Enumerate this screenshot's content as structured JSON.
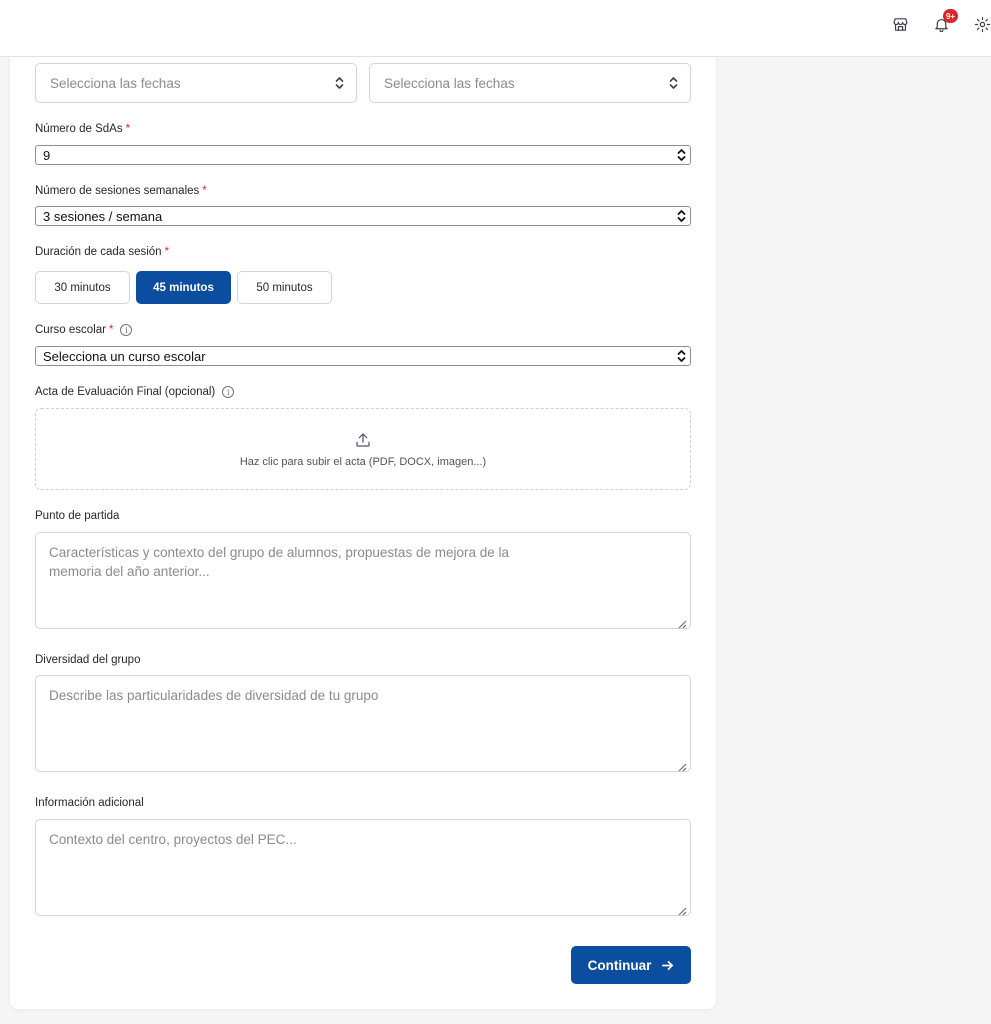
{
  "header": {
    "notification_badge": "9+",
    "icons": [
      "store-icon",
      "bell-icon",
      "gear-icon"
    ]
  },
  "form": {
    "date_start": {
      "placeholder": "Selecciona las fechas"
    },
    "date_end": {
      "placeholder": "Selecciona las fechas"
    },
    "sdas": {
      "label": "Número de SdAs",
      "required": "*",
      "value": "9"
    },
    "sessions": {
      "label": "Número de sesiones semanales",
      "required": "*",
      "value": "3 sesiones / semana"
    },
    "duration": {
      "label": "Duración de cada sesión",
      "required": "*",
      "options": [
        "30 minutos",
        "45 minutos",
        "50 minutos"
      ],
      "selected": "45 minutos"
    },
    "course": {
      "label": "Curso escolar",
      "required": "*",
      "value": "Selecciona un curso escolar"
    },
    "acta": {
      "label": "Acta de Evaluación Final (opcional)",
      "upload_text": "Haz clic para subir el acta (PDF, DOCX, imagen...)"
    },
    "punto_partida": {
      "label": "Punto de partida",
      "placeholder": "Características y contexto del grupo de alumnos, propuestas de mejora de la memoria del año anterior..."
    },
    "diversidad": {
      "label": "Diversidad del grupo",
      "placeholder": "Describe las particularidades de diversidad de tu grupo"
    },
    "info_adicional": {
      "label": "Información adicional",
      "placeholder": "Contexto del centro, proyectos del PEC..."
    },
    "continue_label": "Continuar"
  },
  "colors": {
    "primary": "#0b4d9e",
    "required": "#dc2626",
    "badge": "#dc2626"
  }
}
